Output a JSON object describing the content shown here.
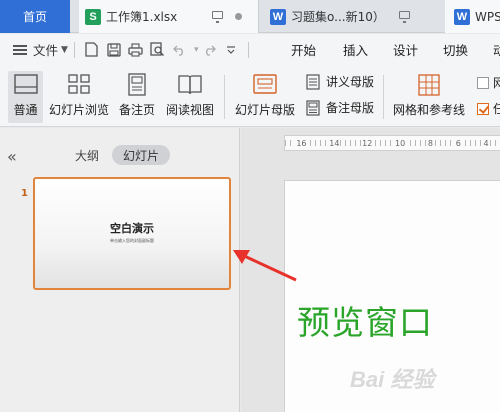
{
  "tabs": {
    "home": "首页",
    "tab1": "工作簿1.xlsx",
    "tab1_icon": "S",
    "tab2": "习题集o...新10）",
    "tab2_icon": "W",
    "tab3": "WPS",
    "tab3_icon": "W"
  },
  "menubar": {
    "file": "文件",
    "items": [
      "开始",
      "插入",
      "设计",
      "切换",
      "动"
    ]
  },
  "ribbon": {
    "normal": "普通",
    "slide_browse": "幻灯片浏览",
    "notes_page": "备注页",
    "reading_view": "阅读视图",
    "slide_master": "幻灯片母版",
    "handout_master": "讲义母版",
    "notes_master": "备注母版",
    "grid_guides": "网格和参考线",
    "checkbox1": "网",
    "checkbox2": "任"
  },
  "leftpanel": {
    "collapse": "«",
    "outline_tab": "大纲",
    "slides_tab": "幻灯片",
    "slide_number": "1",
    "thumb_title": "空白演示",
    "thumb_subtitle": "单击输入您的封面副标题"
  },
  "ruler": [
    "16",
    "14",
    "12",
    "10",
    "8",
    "6",
    "4"
  ],
  "annotation": {
    "label": "预览窗口"
  },
  "watermark": "Bai 经验",
  "colors": {
    "home_tab": "#2f6fd6",
    "thumb_border": "#e2843c",
    "annotation_text": "#2aa52a",
    "arrow": "#e8312a"
  }
}
